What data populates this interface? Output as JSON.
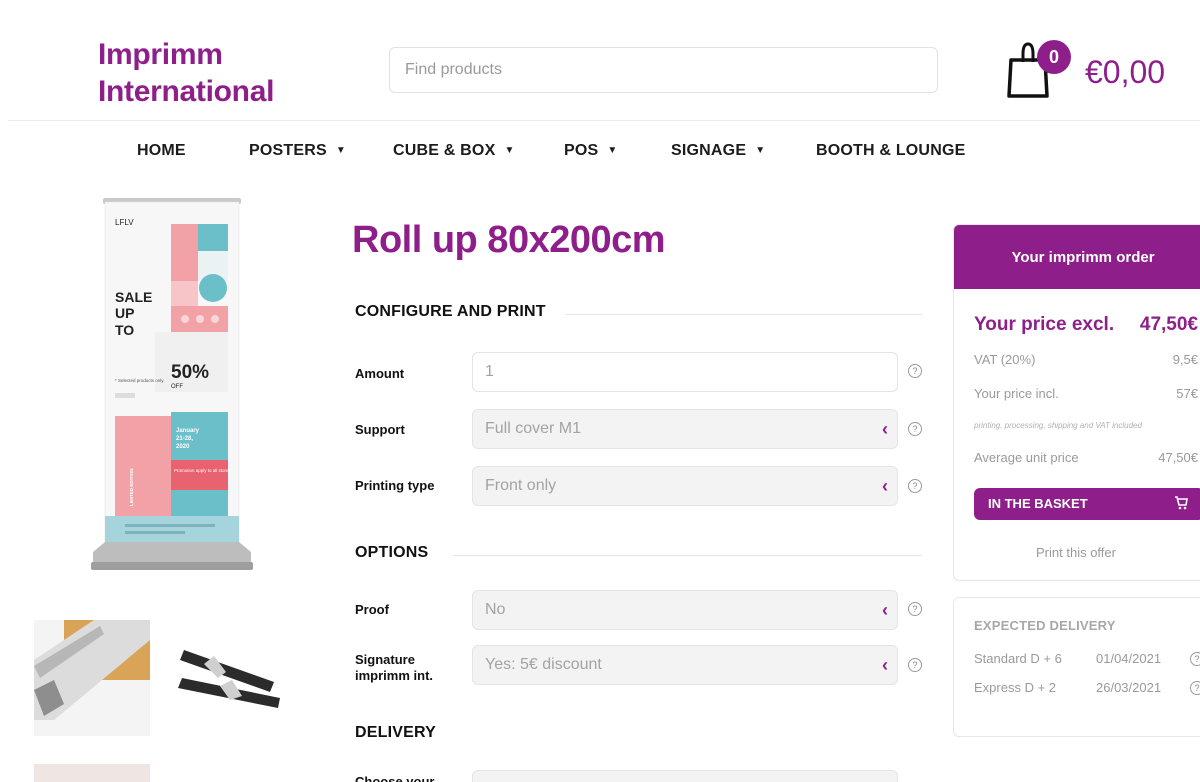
{
  "header": {
    "logo_line1": "Imprimm",
    "logo_line2": "International",
    "search_placeholder": "Find products",
    "cart_count": "0",
    "cart_total": "€0,00"
  },
  "nav": [
    {
      "label": "HOME",
      "has_dropdown": false
    },
    {
      "label": "POSTERS",
      "has_dropdown": true
    },
    {
      "label": "CUBE & BOX",
      "has_dropdown": true
    },
    {
      "label": "POS",
      "has_dropdown": true
    },
    {
      "label": "SIGNAGE",
      "has_dropdown": true
    },
    {
      "label": "BOOTH & LOUNGE",
      "has_dropdown": false
    }
  ],
  "product": {
    "title": "Roll up 80x200cm",
    "image_text": {
      "brand": "LFLV",
      "sale_line1": "SALE",
      "sale_line2": "UP",
      "sale_line3": "TO",
      "percent": "50%",
      "off": "OFF",
      "note": "* Selected products only.",
      "date_line1": "January",
      "date_line2": "21-28,",
      "date_line3": "2020",
      "promo": "Promotion apply to all store.",
      "limited": "LIMITED EDITION"
    }
  },
  "configure": {
    "section_title": "CONFIGURE AND PRINT",
    "amount_label": "Amount",
    "amount_value": "1",
    "support_label": "Support",
    "support_value": "Full cover M1",
    "printing_label": "Printing type",
    "printing_value": "Front only"
  },
  "options": {
    "section_title": "OPTIONS",
    "proof_label": "Proof",
    "proof_value": "No",
    "signature_label_line1": "Signature",
    "signature_label_line2": "imprimm int.",
    "signature_value": "Yes: 5€ discount"
  },
  "delivery_section": {
    "section_title": "DELIVERY",
    "partial_label": "Choose your"
  },
  "help_glyph": "?",
  "order": {
    "title": "Your imprimm order",
    "price_excl_label": "Your price excl.",
    "price_excl_value": "47,50€",
    "vat_label": "VAT (20%)",
    "vat_value": "9,5€",
    "price_incl_label": "Your price incl.",
    "price_incl_value": "57€",
    "note": "printing, processing, shipping and VAT included",
    "avg_label": "Average unit price",
    "avg_value": "47,50€",
    "basket_label": "IN THE BASKET",
    "print_label": "Print this offer"
  },
  "delivery": {
    "title": "EXPECTED DELIVERY",
    "rows": [
      {
        "label": "Standard D + 6",
        "date": "01/04/2021"
      },
      {
        "label": "Express D + 2",
        "date": "26/03/2021"
      }
    ]
  },
  "colors": {
    "accent": "#8e1f8a",
    "pink": "#f2a1a6",
    "teal": "#6bbfc9",
    "red": "#e8626f"
  }
}
